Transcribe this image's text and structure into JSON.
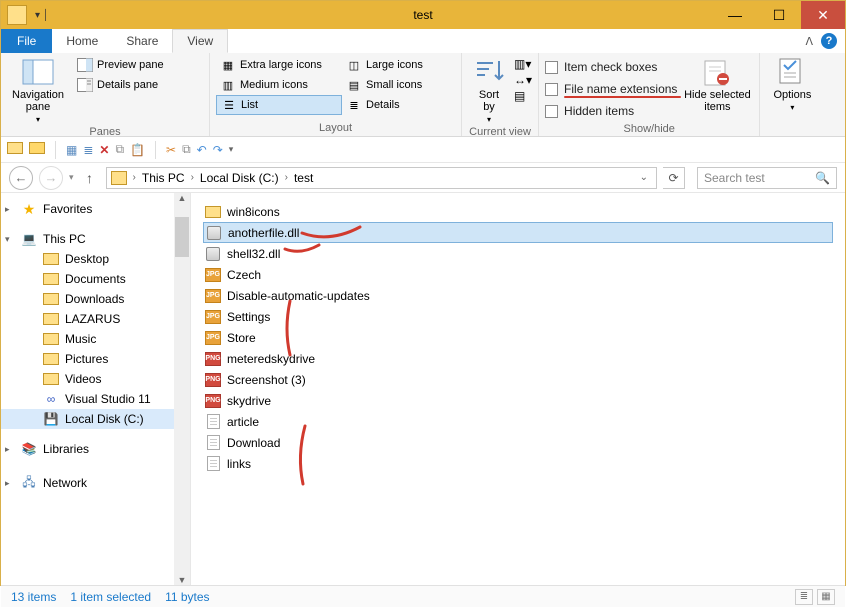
{
  "window": {
    "title": "test"
  },
  "tabs": {
    "file": "File",
    "home": "Home",
    "share": "Share",
    "view": "View"
  },
  "ribbon": {
    "panes": {
      "nav": "Navigation\npane",
      "preview": "Preview pane",
      "details": "Details pane",
      "label": "Panes"
    },
    "layout": {
      "xl": "Extra large icons",
      "lg": "Large icons",
      "md": "Medium icons",
      "sm": "Small icons",
      "list": "List",
      "det": "Details",
      "label": "Layout"
    },
    "current": {
      "sort": "Sort\nby",
      "label": "Current view"
    },
    "showhide": {
      "chk1": "Item check boxes",
      "chk2": "File name extensions",
      "chk3": "Hidden items",
      "hide": "Hide selected\nitems",
      "label": "Show/hide"
    },
    "options": "Options"
  },
  "breadcrumb": [
    "This PC",
    "Local Disk (C:)",
    "test"
  ],
  "search_placeholder": "Search test",
  "tree": {
    "favorites": "Favorites",
    "thispc": "This PC",
    "items": [
      "Desktop",
      "Documents",
      "Downloads",
      "LAZARUS",
      "Music",
      "Pictures",
      "Videos",
      "Visual Studio 11",
      "Local Disk (C:)"
    ],
    "libraries": "Libraries",
    "network": "Network"
  },
  "files": [
    {
      "name": "win8icons",
      "type": "folder",
      "selected": false
    },
    {
      "name": "anotherfile.dll",
      "type": "dll",
      "selected": true
    },
    {
      "name": "shell32.dll",
      "type": "dll",
      "selected": false
    },
    {
      "name": "Czech",
      "type": "jpg",
      "selected": false
    },
    {
      "name": "Disable-automatic-updates",
      "type": "jpg",
      "selected": false
    },
    {
      "name": "Settings",
      "type": "jpg",
      "selected": false
    },
    {
      "name": "Store",
      "type": "jpg",
      "selected": false
    },
    {
      "name": "meteredskydrive",
      "type": "png",
      "selected": false
    },
    {
      "name": "Screenshot (3)",
      "type": "png",
      "selected": false
    },
    {
      "name": "skydrive",
      "type": "png",
      "selected": false
    },
    {
      "name": "article",
      "type": "txt",
      "selected": false
    },
    {
      "name": "Download",
      "type": "txt",
      "selected": false
    },
    {
      "name": "links",
      "type": "txt",
      "selected": false
    }
  ],
  "status": {
    "count": "13 items",
    "selected": "1 item selected",
    "size": "11 bytes"
  }
}
